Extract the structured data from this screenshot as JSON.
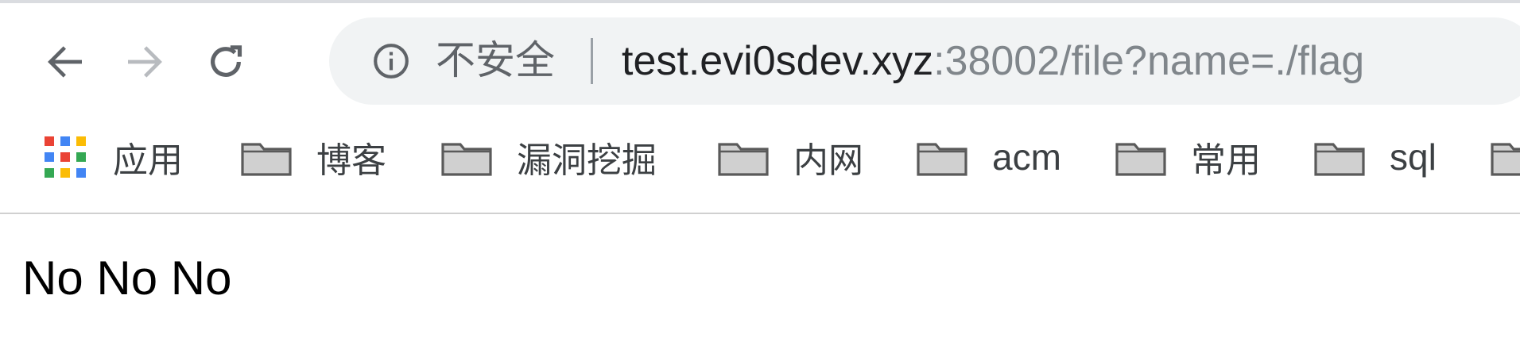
{
  "toolbar": {
    "back_icon": "arrow-left-icon",
    "forward_icon": "arrow-right-icon",
    "reload_icon": "reload-icon"
  },
  "omnibox": {
    "info_icon": "info-icon",
    "security_label": "不安全",
    "url_host": "test.evi0sdev.xyz",
    "url_rest": ":38002/file?name=./flag"
  },
  "bookmarks": {
    "apps_label": "应用",
    "items": [
      {
        "label": "博客"
      },
      {
        "label": "漏洞挖掘"
      },
      {
        "label": "内网"
      },
      {
        "label": "acm"
      },
      {
        "label": "常用"
      },
      {
        "label": "sql"
      }
    ]
  },
  "page": {
    "body_text": "No No No"
  },
  "colors": {
    "omnibox_bg": "#f1f3f4",
    "url_host": "#202124",
    "url_rest": "#80868b",
    "apps_grid": [
      "#ea4335",
      "#4285f4",
      "#fbbc05",
      "#34a853"
    ]
  }
}
